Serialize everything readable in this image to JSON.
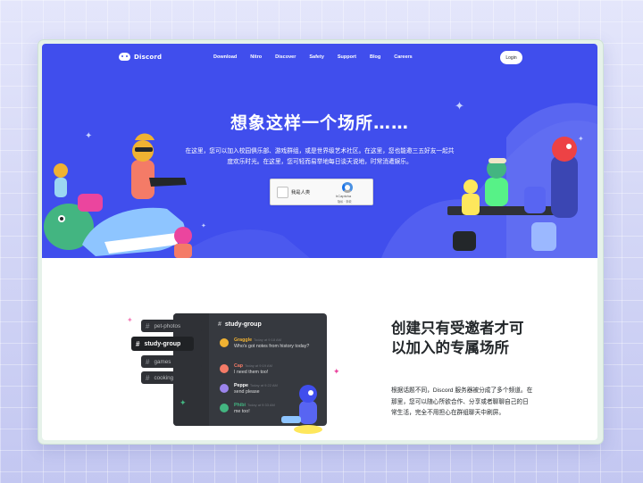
{
  "nav": {
    "brand": "Discord",
    "links": [
      "Download",
      "Nitro",
      "Discover",
      "Safety",
      "Support",
      "Blog",
      "Careers"
    ],
    "login": "Login"
  },
  "hero": {
    "title": "想象这样一个场所……",
    "description": "在这里，您可以加入校园俱乐部、游戏群组，或是世界级艺术社区。在这里，您也能邀三五好友一起共度欢乐时光。在这里，您可轻而易举地每日谈天说地，时常消遣娱乐。",
    "captcha": {
      "label": "我是人类",
      "brand": "hCaptcha",
      "terms": "隐私 · 条款"
    }
  },
  "section2": {
    "title": "创建只有受邀者才可以加入的专属场所",
    "description": "根据话题不同，Discord 服务器被分成了多个频道。在那里，您可以随心所欲合作、分享或者聊聊自己的日常生活，完全不用担心在群组聊天中刷屏。"
  },
  "chat": {
    "header_channel": "study-group",
    "channels": [
      {
        "label": "pet-photos",
        "active": false
      },
      {
        "label": "study-group",
        "active": true
      },
      {
        "label": "games",
        "active": false
      },
      {
        "label": "cooking",
        "active": false
      }
    ],
    "messages": [
      {
        "name": "Graggle",
        "time": "Today at 9:18 AM",
        "text": "Who's got notes from history today?",
        "color": "#f0b232"
      },
      {
        "name": "Cap",
        "time": "Today at 9:19 AM",
        "text": "I need them too!",
        "color": "#f47b67"
      },
      {
        "name": "Peppe",
        "time": "Today at 9:22 AM",
        "text": "send please",
        "color": "#ffffff"
      },
      {
        "name": "Phibi",
        "time": "Today at 9:33 AM",
        "text": "me too!",
        "color": "#43b581"
      }
    ]
  },
  "colors": {
    "blurple": "#404eed",
    "dark_panel": "#36393f",
    "text_dark": "#23272a"
  }
}
